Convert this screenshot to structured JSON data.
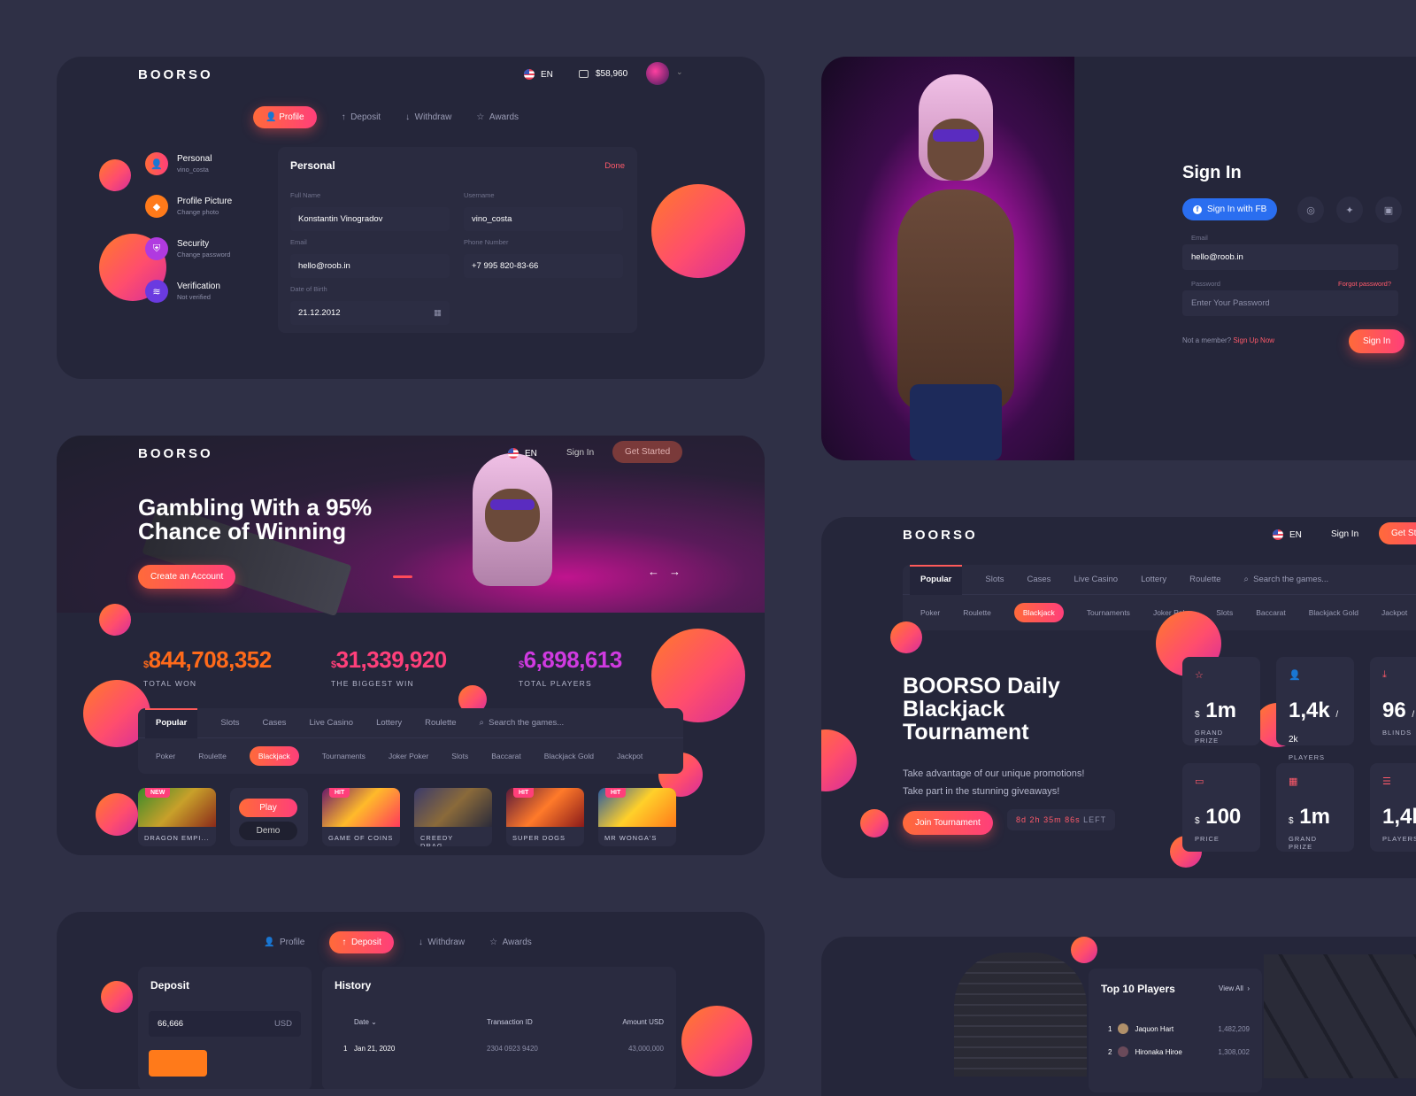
{
  "profile_panel": {
    "brand": "BOORSO",
    "lang": "EN",
    "balance": "$58,960",
    "tabs": [
      "Profile",
      "Deposit",
      "Withdraw",
      "Awards"
    ],
    "menu": [
      {
        "title": "Personal",
        "sub": "vino_costa"
      },
      {
        "title": "Profile Picture",
        "sub": "Change photo"
      },
      {
        "title": "Security",
        "sub": "Change password"
      },
      {
        "title": "Verification",
        "sub": "Not verified"
      }
    ],
    "form_title": "Personal",
    "done": "Done",
    "fields": {
      "full_name_label": "Full Name",
      "full_name": "Konstantin Vinogradov",
      "username_label": "Username",
      "username": "vino_costa",
      "email_label": "Email",
      "email": "hello@roob.in",
      "phone_label": "Phone Number",
      "phone": "+7 995 820-83-66",
      "dob_label": "Date of Birth",
      "dob": "21.12.2012"
    }
  },
  "signin_panel": {
    "title": "Sign In",
    "fb_button": "Sign In with FB",
    "email_label": "Email",
    "email_value": "hello@roob.in",
    "password_label": "Password",
    "forgot": "Forgot password?",
    "password_placeholder": "Enter Your Password",
    "not_member": "Not a member?",
    "signup": "Sign Up Now",
    "signin_button": "Sign In"
  },
  "landing_panel": {
    "brand": "BOORSO",
    "lang": "EN",
    "signin": "Sign In",
    "get_started": "Get Started",
    "hero_line1": "Gambling With a 95%",
    "hero_line2": "Chance of Winning",
    "cta": "Create an Account",
    "stats": [
      {
        "currency": "$",
        "value": "844,708,352",
        "label": "TOTAL WON"
      },
      {
        "currency": "$",
        "value": "31,339,920",
        "label": "THE BIGGEST WIN"
      },
      {
        "currency": "$",
        "value": "6,898,613",
        "label": "TOTAL PLAYERS"
      }
    ],
    "tabs": [
      "Popular",
      "Slots",
      "Cases",
      "Live Casino",
      "Lottery",
      "Roulette"
    ],
    "search_placeholder": "Search the games...",
    "subcats": [
      "Poker",
      "Roulette",
      "Blackjack",
      "Tournaments",
      "Joker Poker",
      "Slots",
      "Baccarat",
      "Blackjack Gold",
      "Jackpot"
    ],
    "games": [
      {
        "name": "DRAGON EMPI...",
        "badge": "NEW"
      },
      {
        "name": "",
        "badge": ""
      },
      {
        "name": "GAME OF COINS",
        "badge": "HIT"
      },
      {
        "name": "CREEDY DRAG...",
        "badge": ""
      },
      {
        "name": "SUPER DOGS",
        "badge": "HIT"
      },
      {
        "name": "MR WONGA'S",
        "badge": "HIT"
      }
    ],
    "play": "Play",
    "demo": "Demo"
  },
  "tournament_panel": {
    "brand": "BOORSO",
    "lang": "EN",
    "signin": "Sign In",
    "get_started": "Get Sta",
    "tabs": [
      "Popular",
      "Slots",
      "Cases",
      "Live Casino",
      "Lottery",
      "Roulette"
    ],
    "search_placeholder": "Search the games...",
    "subcats": [
      "Poker",
      "Roulette",
      "Blackjack",
      "Tournaments",
      "Joker Poker",
      "Slots",
      "Baccarat",
      "Blackjack Gold",
      "Jackpot"
    ],
    "title_l1": "BOORSO Daily",
    "title_l2": "Blackjack",
    "title_l3": "Tournament",
    "desc_l1": "Take advantage of our unique promotions!",
    "desc_l2": "Take part in the stunning giveaways!",
    "join": "Join Tournament",
    "timer": {
      "d": "8",
      "h": "2",
      "m": "35",
      "s": "86",
      "left": "LEFT"
    },
    "cards": [
      {
        "cur": "$",
        "val": "1m",
        "sub": "",
        "cap": "GRAND PRIZE"
      },
      {
        "cur": "",
        "val": "1,4k",
        "sub": "/ 2k",
        "cap": "PLAYERS"
      },
      {
        "cur": "",
        "val": "96",
        "sub": "/ 2",
        "cap": "BLINDS"
      },
      {
        "cur": "$",
        "val": "100",
        "sub": "",
        "cap": "PRICE"
      },
      {
        "cur": "$",
        "val": "1m",
        "sub": "",
        "cap": "GRAND PRIZE"
      },
      {
        "cur": "",
        "val": "1,4k",
        "sub": "",
        "cap": "PLAYERS"
      }
    ]
  },
  "deposit_panel": {
    "tabs": [
      "Profile",
      "Deposit",
      "Withdraw",
      "Awards"
    ],
    "deposit_title": "Deposit",
    "amount": "66,666",
    "currency": "USD",
    "history_title": "History",
    "cols": [
      "Date",
      "Transaction ID",
      "Amount USD"
    ],
    "row": {
      "n": "1",
      "date": "Jan 21, 2020",
      "tx": "2304 0923 9420",
      "amount": "43,000,000"
    }
  },
  "leaders_panel": {
    "title": "Top 10 Players",
    "view_all": "View All",
    "players": [
      {
        "rank": "1",
        "name": "Jaquon Hart",
        "score": "1,482,209"
      },
      {
        "rank": "2",
        "name": "Hironaka Hiroe",
        "score": "1,308,002"
      }
    ]
  }
}
